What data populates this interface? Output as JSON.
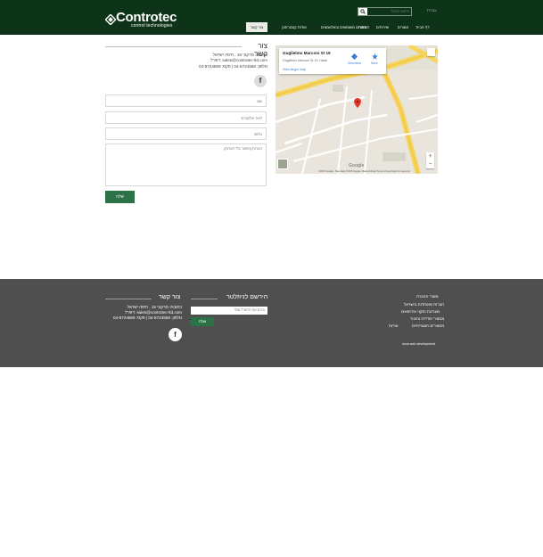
{
  "header": {
    "logo_word": "Controtec",
    "logo_sub": "control technologies",
    "top_link": "עברית",
    "search_placeholder": "חיפוש באתר",
    "nav": [
      {
        "label": "דף הבית",
        "active": false
      },
      {
        "label": "מוצרים",
        "active": false
      },
      {
        "label": "שירותים",
        "active": false
      },
      {
        "label": "הורדות",
        "active": false
      },
      {
        "label": "מוצרים משומשים ובאלאמצים",
        "active": false
      },
      {
        "label": "אודות קונטרוטק",
        "active": false
      },
      {
        "label": "צור קשר",
        "active": true
      }
    ]
  },
  "contact": {
    "title": "צור קשר",
    "address": "כתובת: מרקוני 19 , חיפה ישראל",
    "email": "דוא\"ל: sales@controtec-ltd.com",
    "phone": "טלפון: 04-8724558 | פקס: 04-8724559",
    "facebook_glyph": "f"
  },
  "form": {
    "name_placeholder": "שם",
    "email_placeholder": "דואר אלקטרוני",
    "phone_placeholder": "טלפון",
    "message_placeholder": "הערות (אפשר בלי הערות)",
    "send_label": "שלח"
  },
  "map": {
    "place_title": "Guglielmo Marconi St 19",
    "place_address": "Guglielmo Marconi St 19, Haifa",
    "larger_map": "View larger map",
    "directions": "Directions",
    "save": "Save",
    "brand": "Google",
    "attribution": "©2015 Google - Map data ©2015 Google, Mapa GISrael   Terms of Use   Report a map error",
    "zoom_in": "+",
    "zoom_out": "−"
  },
  "footer": {
    "contact_title": "צור קשר",
    "contact_address": "כתובת: מרקוני 19 , חיפה ישראל",
    "contact_email": "דוא\"ל: sales@controtec-ltd.com",
    "contact_phone": "טלפון: 04-8724558 | פקס: 04-8724559",
    "facebook_glyph": "f",
    "newsletter_title": "הירשם לניוזלטר",
    "newsletter_placeholder": "הכנס את הדוא\"ל שלך",
    "newsletter_button": "שלח",
    "links_heading": "מוצרי החברה",
    "links": [
      "חברות מאוחדות בישראל",
      "מערכות ותקני אירופאים",
      "מכשירי מדידה וחיבור",
      "מכשירים תעשייתיים"
    ],
    "about_link": "אודות",
    "credit": "nova web development"
  }
}
